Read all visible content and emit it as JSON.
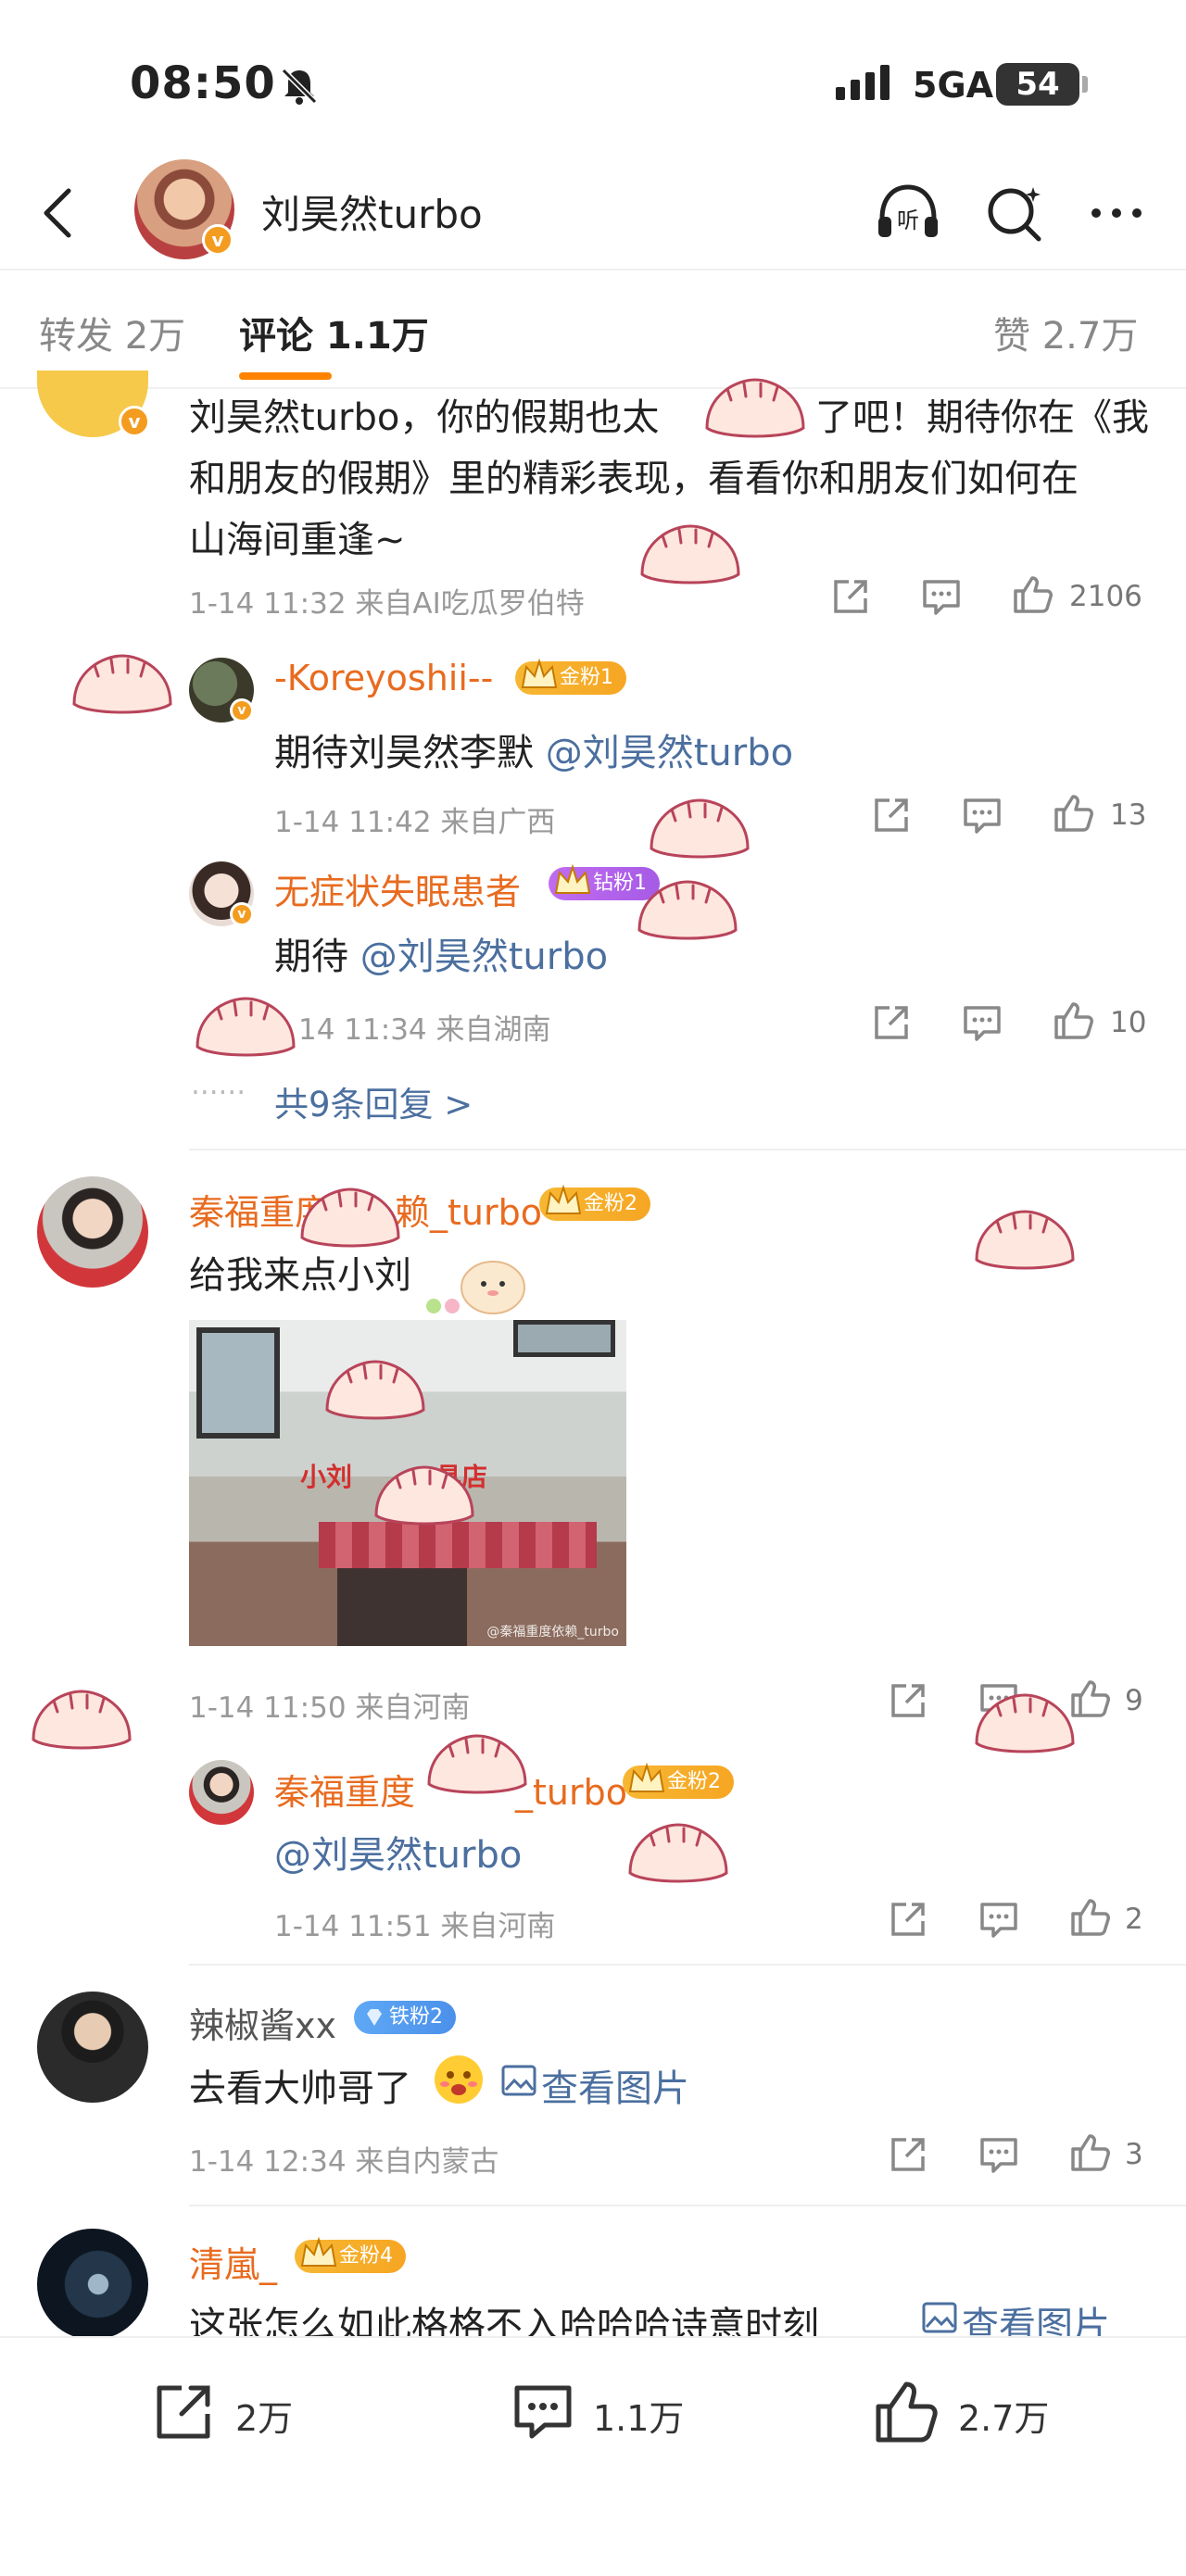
{
  "status_bar": {
    "time": "08:50",
    "network": "5GA",
    "battery": "54"
  },
  "header": {
    "title": "刘昊然turbo"
  },
  "tabs": [
    {
      "label": "转发 2万"
    },
    {
      "label": "评论 1.1万"
    },
    {
      "label": "赞 2.7万"
    }
  ],
  "comments": {
    "c1": {
      "line1": "刘昊然turbo，你的假期也太",
      "line1b": "了吧！期待你在《我",
      "line2": "和朋友的假期》里的精彩表现，看看你和朋友们如何在",
      "line3": "山海间重逢~",
      "meta": "1-14 11:32  来自AI吃瓜罗伯特",
      "likes": "2106",
      "replies": [
        {
          "name": "-Koreyoshii--",
          "badge": "金粉1",
          "text_prefix": "期待刘昊然李默 ",
          "mention": "@刘昊然turbo",
          "meta": "1-14 11:42  来自广西",
          "likes": "13"
        },
        {
          "name": "无症状失眠患者",
          "badge": "钻粉1",
          "text_prefix": "期待 ",
          "mention": "@刘昊然turbo",
          "meta": "14 11:34  来自湖南",
          "likes": "10"
        }
      ],
      "more_replies": "共9条回复 >"
    },
    "c2": {
      "name": "秦福重度",
      "name_tail": "赖_turbo",
      "badge": "金粉2",
      "text": "给我来点小刘",
      "photo_sign": "小刘",
      "photo_sign_tail": "具店",
      "photo_watermark": "@秦福重度依赖_turbo",
      "meta": "1-14 11:50  来自河南",
      "likes": "9",
      "reply": {
        "name": "秦福重度",
        "name_tail": "_turbo",
        "badge": "金粉2",
        "mention": "@刘昊然turbo",
        "meta": "1-14 11:51  来自河南",
        "likes": "2"
      }
    },
    "c3": {
      "name": "辣椒酱xx",
      "badge": "铁粉2",
      "text": "去看大帅哥了",
      "link": "查看图片",
      "meta": "1-14 12:34  来自内蒙古",
      "likes": "3"
    },
    "c4": {
      "name": "清嵐_",
      "badge": "金粉4",
      "text": "这张怎么如此格格不入哈哈哈诗意时刻",
      "link": "查看图片"
    }
  },
  "bottom_bar": {
    "repost": "2万",
    "comment": "1.1万",
    "like": "2.7万"
  },
  "colors": {
    "accent": "#ff8200",
    "name_orange": "#e86b1f",
    "link": "#4b6f9f",
    "gold_badge": "#f6a623",
    "diamond_badge": "#a65be6",
    "iron_badge": "#4b90ea"
  }
}
